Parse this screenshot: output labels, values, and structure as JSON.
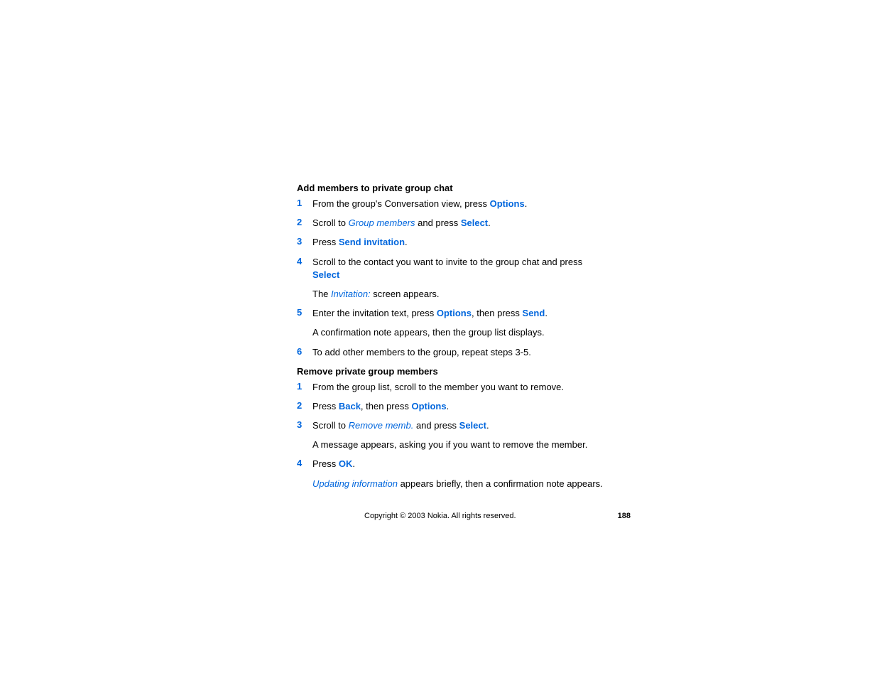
{
  "section1": {
    "heading": "Add members to private group chat",
    "steps": [
      {
        "num": "1",
        "parts": [
          {
            "t": "From the group's Conversation view, press ",
            "c": ""
          },
          {
            "t": "Options",
            "c": "bold-blue"
          },
          {
            "t": ".",
            "c": ""
          }
        ]
      },
      {
        "num": "2",
        "parts": [
          {
            "t": "Scroll to ",
            "c": ""
          },
          {
            "t": "Group members",
            "c": "italic-blue"
          },
          {
            "t": " and press ",
            "c": ""
          },
          {
            "t": "Select",
            "c": "bold-blue"
          },
          {
            "t": ".",
            "c": ""
          }
        ]
      },
      {
        "num": "3",
        "parts": [
          {
            "t": "Press ",
            "c": ""
          },
          {
            "t": "Send invitation",
            "c": "bold-blue"
          },
          {
            "t": ".",
            "c": ""
          }
        ]
      },
      {
        "num": "4",
        "parts": [
          {
            "t": "Scroll to the contact you want to invite to the group chat and press ",
            "c": ""
          },
          {
            "t": "Select",
            "c": "bold-blue"
          }
        ],
        "followup_parts": [
          {
            "t": "The ",
            "c": ""
          },
          {
            "t": "Invitation:",
            "c": "italic-blue"
          },
          {
            "t": " screen appears.",
            "c": ""
          }
        ]
      },
      {
        "num": "5",
        "parts": [
          {
            "t": "Enter the invitation text, press ",
            "c": ""
          },
          {
            "t": "Options",
            "c": "bold-blue"
          },
          {
            "t": ", then press ",
            "c": ""
          },
          {
            "t": "Send",
            "c": "bold-blue"
          },
          {
            "t": ".",
            "c": ""
          }
        ],
        "followup_parts": [
          {
            "t": "A confirmation note appears, then the group list displays.",
            "c": ""
          }
        ]
      },
      {
        "num": "6",
        "parts": [
          {
            "t": "To add other members to the group, repeat steps 3-5.",
            "c": ""
          }
        ]
      }
    ]
  },
  "section2": {
    "heading": "Remove private group members",
    "steps": [
      {
        "num": "1",
        "parts": [
          {
            "t": "From the group list, scroll to the member you want to remove.",
            "c": ""
          }
        ]
      },
      {
        "num": "2",
        "parts": [
          {
            "t": "Press ",
            "c": ""
          },
          {
            "t": "Back",
            "c": "bold-blue"
          },
          {
            "t": ", then press ",
            "c": ""
          },
          {
            "t": "Options",
            "c": "bold-blue"
          },
          {
            "t": ".",
            "c": ""
          }
        ]
      },
      {
        "num": "3",
        "parts": [
          {
            "t": "Scroll to ",
            "c": ""
          },
          {
            "t": "Remove memb.",
            "c": "italic-blue"
          },
          {
            "t": " and press ",
            "c": ""
          },
          {
            "t": "Select",
            "c": "bold-blue"
          },
          {
            "t": ".",
            "c": ""
          }
        ],
        "followup_parts": [
          {
            "t": "A message appears, asking you if you want to remove the member.",
            "c": ""
          }
        ]
      },
      {
        "num": "4",
        "parts": [
          {
            "t": "Press ",
            "c": ""
          },
          {
            "t": "OK",
            "c": "bold-blue"
          },
          {
            "t": ".",
            "c": ""
          }
        ],
        "followup_parts": [
          {
            "t": "Updating information",
            "c": "italic-blue"
          },
          {
            "t": " appears briefly, then a confirmation note appears.",
            "c": ""
          }
        ]
      }
    ]
  },
  "footer": {
    "copyright": "Copyright © 2003 Nokia. All rights reserved.",
    "page": "188"
  }
}
